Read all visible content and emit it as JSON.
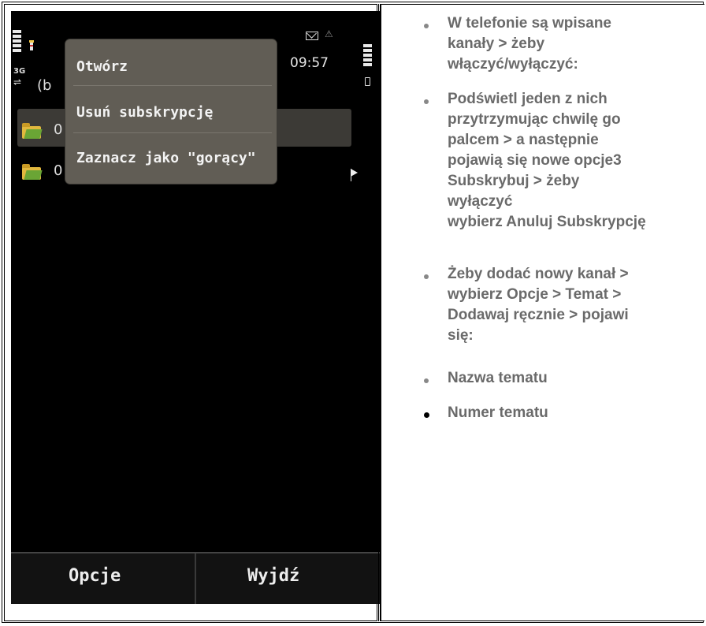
{
  "phone": {
    "clock": "09:57",
    "network": "3G",
    "title_partial": "(b",
    "list": [
      {
        "label": "0",
        "highlighted": true
      },
      {
        "label": "0",
        "highlighted": false
      }
    ],
    "context_menu": {
      "items": [
        "Otwórz",
        "Usuń subskrypcję",
        "Zaznacz jako \"gorący\""
      ]
    },
    "softkeys": {
      "left": "Opcje",
      "right": "Wyjdź"
    },
    "colors": {
      "menu_bg": "#615d55",
      "folder": "#e1b83e",
      "screen_bg": "#000000"
    }
  },
  "instructions": {
    "lines": [
      "W telefonie są wpisane",
      "kanały > żeby",
      "włączyć/wyłączyć:",
      "Podświetl jeden z nich",
      "przytrzymując chwilę go",
      "palcem > a następnie",
      "pojawią się nowe opcje3",
      "Subskrybuj > żeby",
      "wyłączyć",
      "wybierz Anuluj Subskrypcję",
      "Żeby dodać nowy kanał >",
      "wybierz Opcje > Temat >",
      "Dodawaj ręcznie > pojawi",
      "się:",
      "Nazwa tematu",
      "Numer tematu"
    ]
  }
}
